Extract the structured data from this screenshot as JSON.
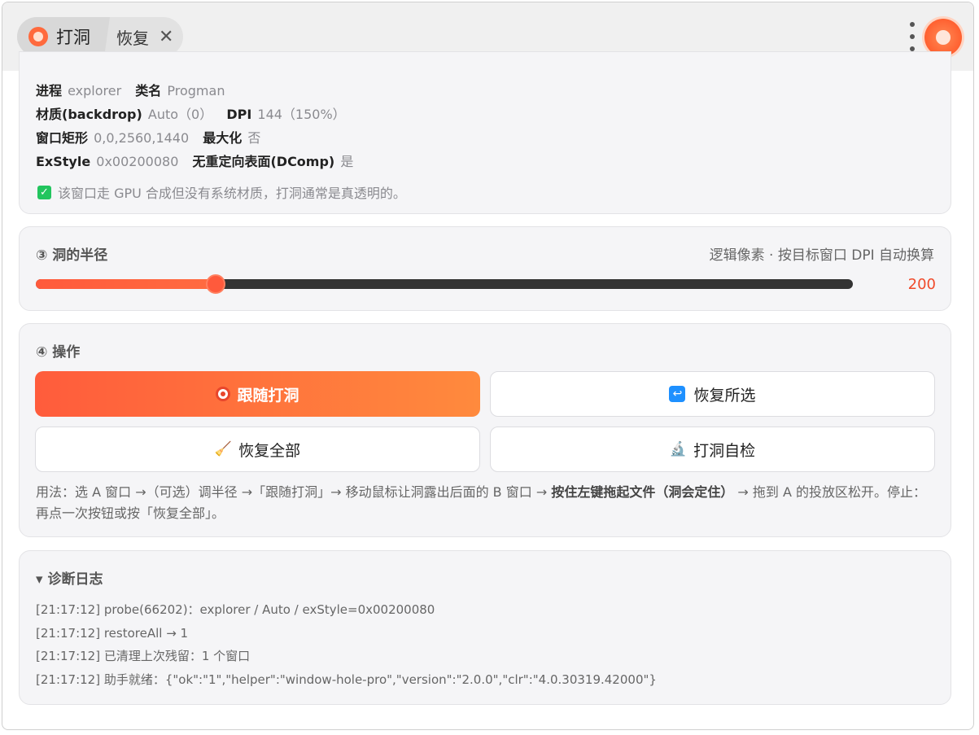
{
  "tabs": {
    "active_label": "打洞",
    "inactive_label": "恢复",
    "close_symbol": "✕"
  },
  "info": {
    "process_label": "进程",
    "process_value": "explorer",
    "class_label": "类名",
    "class_value": "Progman",
    "material_label": "材质(backdrop)",
    "material_value": "Auto（0）",
    "dpi_label": "DPI",
    "dpi_value": "144（150%）",
    "rect_label": "窗口矩形",
    "rect_value": "0,0,2560,1440",
    "max_label": "最大化",
    "max_value": "否",
    "exstyle_label": "ExStyle",
    "exstyle_value": "0x00200080",
    "dcomp_label": "无重定向表面(DComp)",
    "dcomp_value": "是",
    "check_text": "该窗口走 GPU 合成但没有系统材质，打洞通常是真透明的。"
  },
  "radius": {
    "title": "③ 洞的半径",
    "hint": "逻辑像素 · 按目标窗口 DPI 自动换算",
    "value": "200",
    "fraction": 0.22
  },
  "ops": {
    "title": "④ 操作",
    "follow_label": "跟随打洞",
    "restore_selected_label": "恢复所选",
    "restore_all_label": "恢复全部",
    "self_check_label": "打洞自检",
    "usage_pre": "用法：选 A 窗口 →（可选）调半径 →「跟随打洞」→ 移动鼠标让洞露出后面的 B 窗口 → ",
    "usage_bold": "按住左键拖起文件（洞会定住）",
    "usage_post": " → 拖到 A 的投放区松开。停止：再点一次按钮或按「恢复全部」。"
  },
  "log": {
    "title": "▾ 诊断日志",
    "lines": [
      "[21:17:12] probe(66202)：explorer / Auto / exStyle=0x00200080",
      "[21:17:12] restoreAll → 1",
      "[21:17:12] 已清理上次残留：1 个窗口",
      "[21:17:12] 助手就绪：{\"ok\":\"1\",\"helper\":\"window-hole-pro\",\"version\":\"2.0.0\",\"clr\":\"4.0.30319.42000\"}"
    ]
  },
  "colors": {
    "accent": "#ff5c3c",
    "accent_end": "#ff8a3d",
    "check_green": "#22c55e",
    "value_red": "#f04a2a"
  },
  "icons": {
    "tab": "hole-icon",
    "menu": "more-vertical-icon",
    "avatar": "app-avatar-icon",
    "follow": "target-icon",
    "restore_selected": "return-icon",
    "restore_all": "broom-icon",
    "self_check": "microscope-icon",
    "check": "checkbox-checked-icon"
  }
}
